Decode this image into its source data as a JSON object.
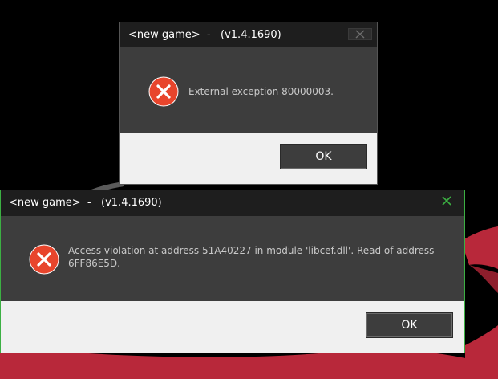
{
  "background": {
    "description_color": "#b8283a"
  },
  "dialog_back": {
    "title": "<new game>  -   (v1.4.1690)",
    "message": "External exception 80000003.",
    "ok_label": "OK",
    "icon": "error-x-icon",
    "close_icon": "close-icon"
  },
  "dialog_front": {
    "title": "<new game>  -   (v1.4.1690)",
    "message": "Access violation at address 51A40227 in module 'libcef.dll'. Read of address 6FF86E5D.",
    "ok_label": "OK",
    "icon": "error-x-icon",
    "close_icon": "close-icon",
    "accent": "#3cb043"
  },
  "colors": {
    "error_red": "#e8452c",
    "titlebar": "#1e1e1e",
    "body": "#3d3d3d",
    "footer": "#f0f0f0"
  }
}
